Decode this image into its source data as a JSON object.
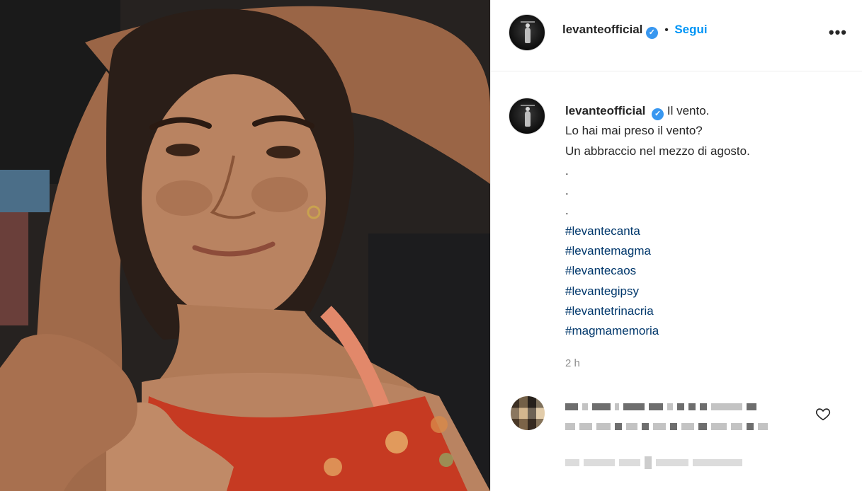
{
  "post": {
    "username": "levanteofficial",
    "verified_glyph": "✓",
    "separator": "•",
    "follow_label": "Segui",
    "more_glyph": "•••"
  },
  "caption": {
    "username": "levanteofficial",
    "lines": [
      "Il vento.",
      "Lo hai mai preso il vento?",
      "Un abbraccio nel mezzo di agosto.",
      ".",
      ".",
      "."
    ],
    "hashtags": [
      "#levantecanta",
      "#levantemagma",
      "#levantecaos",
      "#levantegipsy",
      "#levantetrinacria",
      "#magmamemoria"
    ],
    "time": "2 h"
  },
  "icons": {
    "verified": "verified-badge-icon",
    "more": "more-options-icon",
    "like": "heart-icon"
  },
  "colors": {
    "link": "#0095f6",
    "hashtag": "#00376b",
    "verified": "#3897f0",
    "muted": "#8e8e8e"
  }
}
